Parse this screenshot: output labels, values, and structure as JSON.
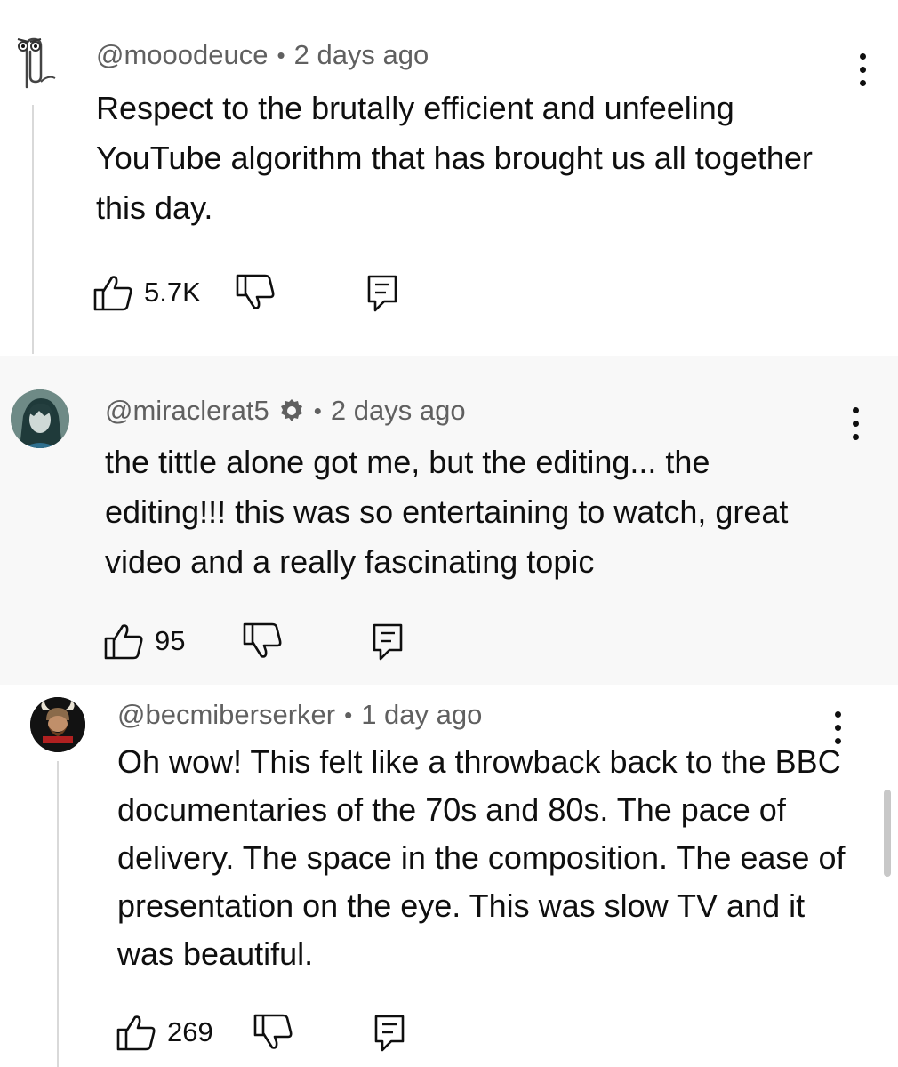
{
  "colors": {
    "text": "#0f0f0f",
    "meta": "#606060",
    "thread_line": "#d9d9d9",
    "highlight_bg": "#f8f8f8"
  },
  "comments": [
    {
      "handle": "@mooodeuce",
      "separator": "•",
      "time": "2 days ago",
      "text": "Respect to the brutally efficient and unfeeling YouTube algorithm that has brought us all together this day.",
      "likes": "5.7K",
      "avatar": "paperclip-avatar",
      "verified": false
    },
    {
      "handle": "@miraclerat5",
      "separator": "•",
      "time": "2 days ago",
      "text": "the tittle alone got me, but the editing... the editing!!! this was so entertaining to watch, great video and a really fascinating topic",
      "likes": "95",
      "avatar": "anime-character-avatar",
      "verified": true
    },
    {
      "handle": "@becmiberserker",
      "separator": "•",
      "time": "1 day ago",
      "text": "Oh wow! This felt like a throwback back to the BBC documentaries of the 70s and 80s. The pace of delivery. The space in the composition. The ease of presentation on the eye. This was slow TV and it was beautiful.",
      "likes": "269",
      "avatar": "viking-logo-avatar",
      "verified": false
    }
  ],
  "icons": {
    "like": "thumbs-up-icon",
    "dislike": "thumbs-down-icon",
    "reply": "reply-icon",
    "more": "more-vertical-icon",
    "badge": "gear-badge-icon"
  }
}
